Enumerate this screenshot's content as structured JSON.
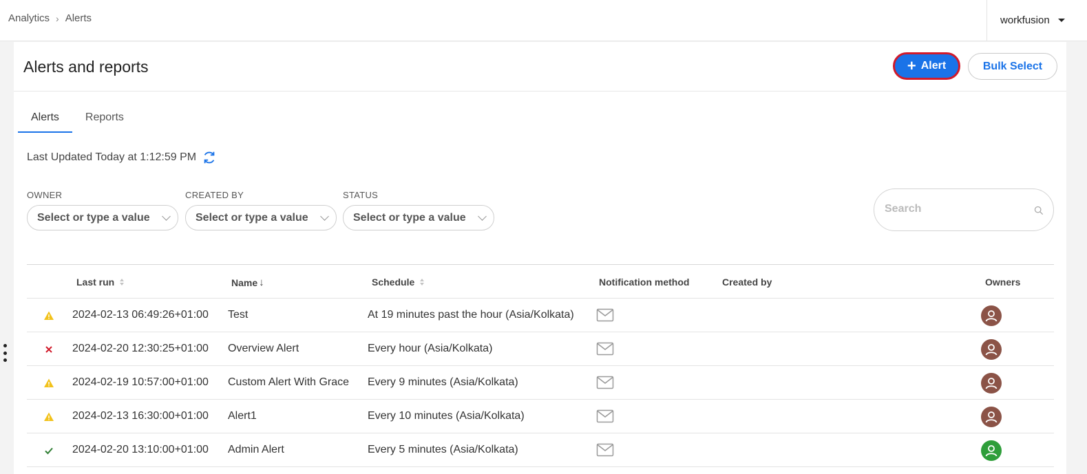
{
  "breadcrumb": {
    "items": [
      "Analytics",
      "Alerts"
    ],
    "separator": ">"
  },
  "user_menu": {
    "label": "workfusion"
  },
  "page": {
    "title": "Alerts and reports",
    "add_alert_button": "Alert",
    "add_alert_icon": "+",
    "bulk_select_button": "Bulk Select"
  },
  "tabs": [
    {
      "label": "Alerts",
      "active": true
    },
    {
      "label": "Reports",
      "active": false
    }
  ],
  "last_updated": "Last Updated Today at 1:12:59 PM",
  "filters": [
    {
      "label": "OWNER",
      "value": "Select or type a value"
    },
    {
      "label": "CREATED BY",
      "value": "Select or type a value"
    },
    {
      "label": "STATUS",
      "value": "Select or type a value"
    }
  ],
  "search": {
    "placeholder": "Search",
    "value": ""
  },
  "table": {
    "columns": [
      "Last run",
      "Name",
      "Schedule",
      "Notification method",
      "Created by",
      "Owners"
    ],
    "rows": [
      {
        "status": "warning",
        "last_run": "2024-02-13 06:49:26+01:00",
        "name": "Test",
        "schedule": "At 19 minutes past the hour (Asia/Kolkata)",
        "notification": "email-icon",
        "created_by": "",
        "owner_color": "#8b5347"
      },
      {
        "status": "error",
        "last_run": "2024-02-20 12:30:25+01:00",
        "name": "Overview Alert",
        "schedule": "Every hour (Asia/Kolkata)",
        "notification": "email-icon",
        "created_by": "",
        "owner_color": "#8b5347"
      },
      {
        "status": "warning",
        "last_run": "2024-02-19 10:57:00+01:00",
        "name": "Custom Alert With Grace",
        "schedule": "Every 9 minutes (Asia/Kolkata)",
        "notification": "email-icon",
        "created_by": "",
        "owner_color": "#8b5347"
      },
      {
        "status": "warning",
        "last_run": "2024-02-13 16:30:00+01:00",
        "name": "Alert1",
        "schedule": "Every 10 minutes (Asia/Kolkata)",
        "notification": "email-icon",
        "created_by": "",
        "owner_color": "#8b5347"
      },
      {
        "status": "success",
        "last_run": "2024-02-20 13:10:00+01:00",
        "name": "Admin Alert",
        "schedule": "Every 5 minutes (Asia/Kolkata)",
        "notification": "email-icon",
        "created_by": "",
        "owner_color": "#2e9e3a"
      }
    ]
  },
  "colors": {
    "primary": "#1a73e8",
    "highlight_border": "#d11a2a",
    "warning": "#f2c21b",
    "error": "#d11a2a",
    "success": "#2e7d32"
  }
}
